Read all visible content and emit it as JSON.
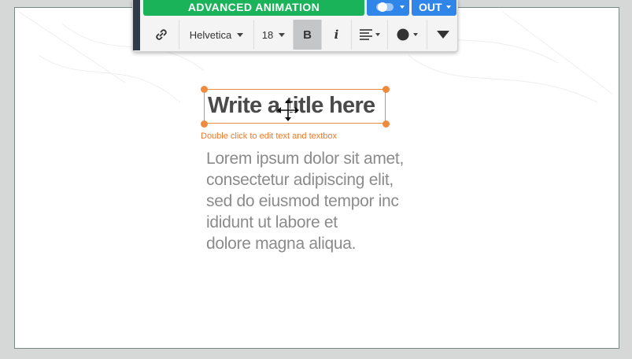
{
  "toolbar": {
    "animation_label": "ADVANCED ANIMATION",
    "out_label": "OUT",
    "font_family": "Helvetica",
    "font_size": "18",
    "bold_label": "B",
    "italic_label": "i"
  },
  "canvas": {
    "title": "Write a title here",
    "hint": "Double click to edit text and textbox",
    "body_lines": [
      "Lorem ipsum dolor sit amet,",
      "consectetur adipiscing elit,",
      "sed do eiusmod tempor inc",
      "ididunt ut labore et",
      "dolore magna aliqua."
    ]
  },
  "colors": {
    "accent_green": "#1bb35a",
    "accent_blue": "#2f86e8",
    "selection_orange": "#f08a3c"
  },
  "icons": [
    "link-icon",
    "align-icon",
    "circle-shape-icon",
    "triangle-down-icon",
    "move-cursor-icon",
    "toggle-icon"
  ]
}
